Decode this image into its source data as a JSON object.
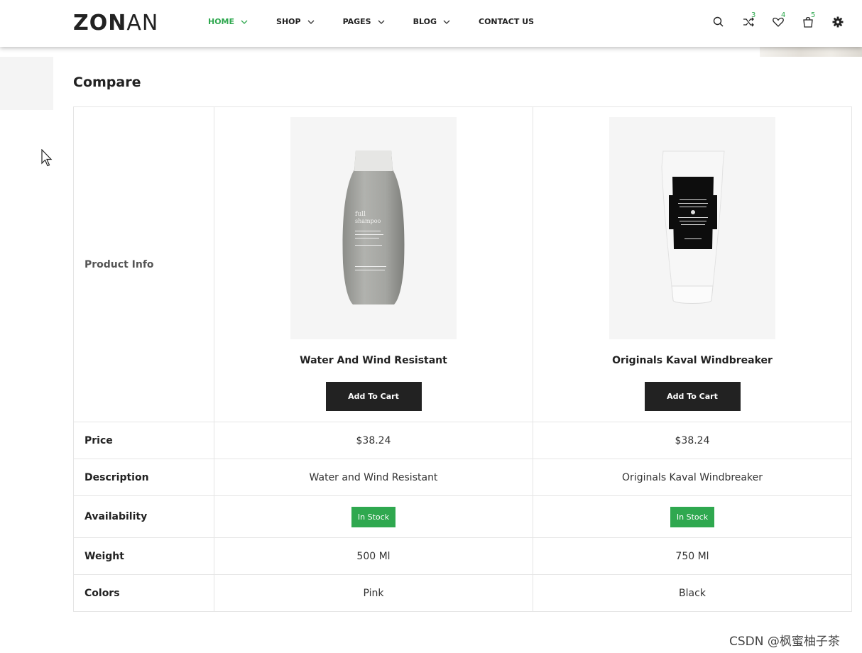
{
  "header": {
    "logo_bold": "ZON",
    "logo_thin": "AN",
    "nav": [
      {
        "label": "HOME",
        "active": true,
        "has_dropdown": true
      },
      {
        "label": "SHOP",
        "active": false,
        "has_dropdown": true
      },
      {
        "label": "PAGES",
        "active": false,
        "has_dropdown": true
      },
      {
        "label": "BLOG",
        "active": false,
        "has_dropdown": true
      },
      {
        "label": "CONTACT US",
        "active": false,
        "has_dropdown": false
      }
    ],
    "icons": [
      {
        "name": "search-icon"
      },
      {
        "name": "compare-icon",
        "count": "3"
      },
      {
        "name": "wishlist-icon",
        "count": "4"
      },
      {
        "name": "cart-icon",
        "count": "5"
      },
      {
        "name": "settings-icon"
      }
    ],
    "accent_color": "#2fa84f"
  },
  "page": {
    "title": "Compare"
  },
  "compare": {
    "labels": {
      "product_info": "Product Info",
      "price": "Price",
      "description": "Description",
      "availability": "Availability",
      "weight": "Weight",
      "colors": "Colors"
    },
    "products": [
      {
        "name": "Water And Wind Resistant",
        "button": "Add To Cart",
        "price": "$38.24",
        "description": "Water and Wind Resistant",
        "availability": "In Stock",
        "weight": "500 Ml",
        "color": "Pink",
        "image": "grey-shampoo-bottle",
        "image_text": {
          "line1": "full",
          "line2": "shampoo"
        }
      },
      {
        "name": "Originals Kaval Windbreaker",
        "button": "Add To Cart",
        "price": "$38.24",
        "description": "Originals Kaval Windbreaker",
        "availability": "In Stock",
        "weight": "750 Ml",
        "color": "Black",
        "image": "white-tube-black-label"
      }
    ]
  },
  "watermark": "CSDN @枫蜜柚子茶"
}
